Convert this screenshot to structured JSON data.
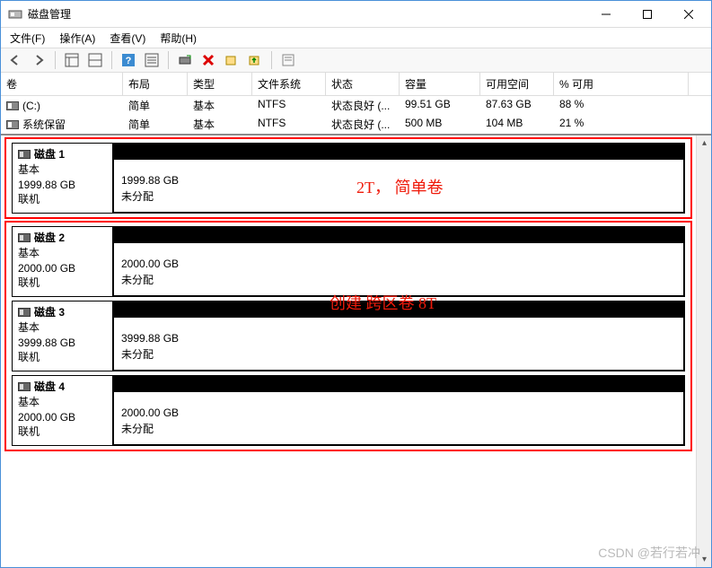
{
  "title": "磁盘管理",
  "menu": {
    "file": "文件(F)",
    "action": "操作(A)",
    "view": "查看(V)",
    "help": "帮助(H)"
  },
  "columns": {
    "volume": "卷",
    "layout": "布局",
    "type": "类型",
    "fs": "文件系统",
    "status": "状态",
    "capacity": "容量",
    "free": "可用空间",
    "pctfree": "% 可用"
  },
  "volumes": [
    {
      "name": "(C:)",
      "layout": "简单",
      "type": "基本",
      "fs": "NTFS",
      "status": "状态良好 (...",
      "capacity": "99.51 GB",
      "free": "87.63 GB",
      "pct": "88 %"
    },
    {
      "name": "系统保留",
      "layout": "简单",
      "type": "基本",
      "fs": "NTFS",
      "status": "状态良好 (...",
      "capacity": "500 MB",
      "free": "104 MB",
      "pct": "21 %"
    }
  ],
  "disks": [
    {
      "name": "磁盘 1",
      "type": "基本",
      "size": "1999.88 GB",
      "state": "联机",
      "part_size": "1999.88 GB",
      "part_state": "未分配"
    },
    {
      "name": "磁盘 2",
      "type": "基本",
      "size": "2000.00 GB",
      "state": "联机",
      "part_size": "2000.00 GB",
      "part_state": "未分配"
    },
    {
      "name": "磁盘 3",
      "type": "基本",
      "size": "3999.88 GB",
      "state": "联机",
      "part_size": "3999.88 GB",
      "part_state": "未分配"
    },
    {
      "name": "磁盘 4",
      "type": "基本",
      "size": "2000.00 GB",
      "state": "联机",
      "part_size": "2000.00 GB",
      "part_state": "未分配"
    }
  ],
  "annotations": {
    "a1": "2T， 简单卷",
    "a2": "创建 跨区卷 8T"
  },
  "watermark": "CSDN @若行若冲"
}
